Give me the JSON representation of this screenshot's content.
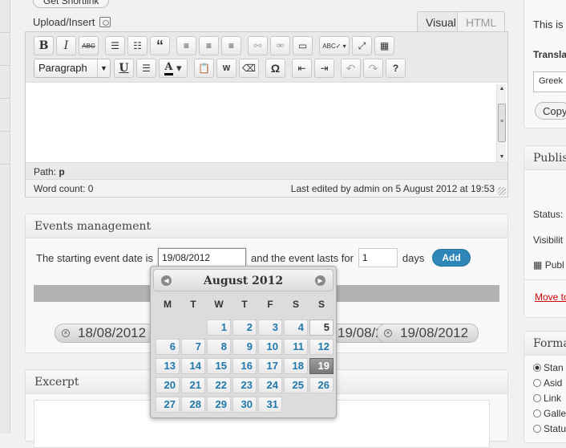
{
  "top_button": "Get Shortlink",
  "upload_label": "Upload/Insert",
  "tabs": {
    "visual": "Visual",
    "html": "HTML"
  },
  "toolbar": {
    "format_select": "Paragraph",
    "buttons": [
      "bold",
      "italic",
      "strikethrough",
      "bullet-list",
      "numbered-list",
      "blockquote",
      "align-left",
      "align-center",
      "align-right",
      "link",
      "unlink",
      "insert-more",
      "spellcheck",
      "fullscreen",
      "kitchen-sink",
      "underline",
      "justify",
      "text-color",
      "paste-text",
      "paste-word",
      "remove-format",
      "special-character",
      "outdent",
      "indent",
      "undo",
      "redo",
      "help"
    ]
  },
  "editor": {
    "path_label": "Path:",
    "path_value": "p",
    "word_count": "Word count: 0",
    "last_edited": "Last edited by admin on 5 August 2012 at 19:53"
  },
  "events": {
    "title": "Events management",
    "label_start": "The starting event date is",
    "date_value": "19/08/2012",
    "label_lasts": "and the event lasts for",
    "duration_value": "1",
    "label_days": "days",
    "add_label": "Add",
    "tags": [
      "18/08/2012",
      "19/08/2012",
      "19/08/2012"
    ]
  },
  "excerpt": {
    "title": "Excerpt"
  },
  "calendar": {
    "month_title": "August 2012",
    "weekdays": [
      "M",
      "T",
      "W",
      "T",
      "F",
      "S",
      "S"
    ],
    "today": "5",
    "selected": "19",
    "first_weekday_index": 2,
    "days_in_month": 31
  },
  "sidebar": {
    "box1": {
      "text": "This is",
      "translate_head": "Transla",
      "lang_field": "Greek",
      "copy_btn": "Copy"
    },
    "box2": {
      "title": "Publis",
      "status": "Status:",
      "visibility": "Visibilit",
      "publish": "Publ",
      "move": "Move to"
    },
    "box3": {
      "title": "Forma",
      "options": [
        "Stan",
        "Asid",
        "Link",
        "Galle",
        "Statu"
      ]
    }
  },
  "colors": {
    "accent": "#2e87b8",
    "link": "#2277aa",
    "danger": "#cc0000"
  }
}
